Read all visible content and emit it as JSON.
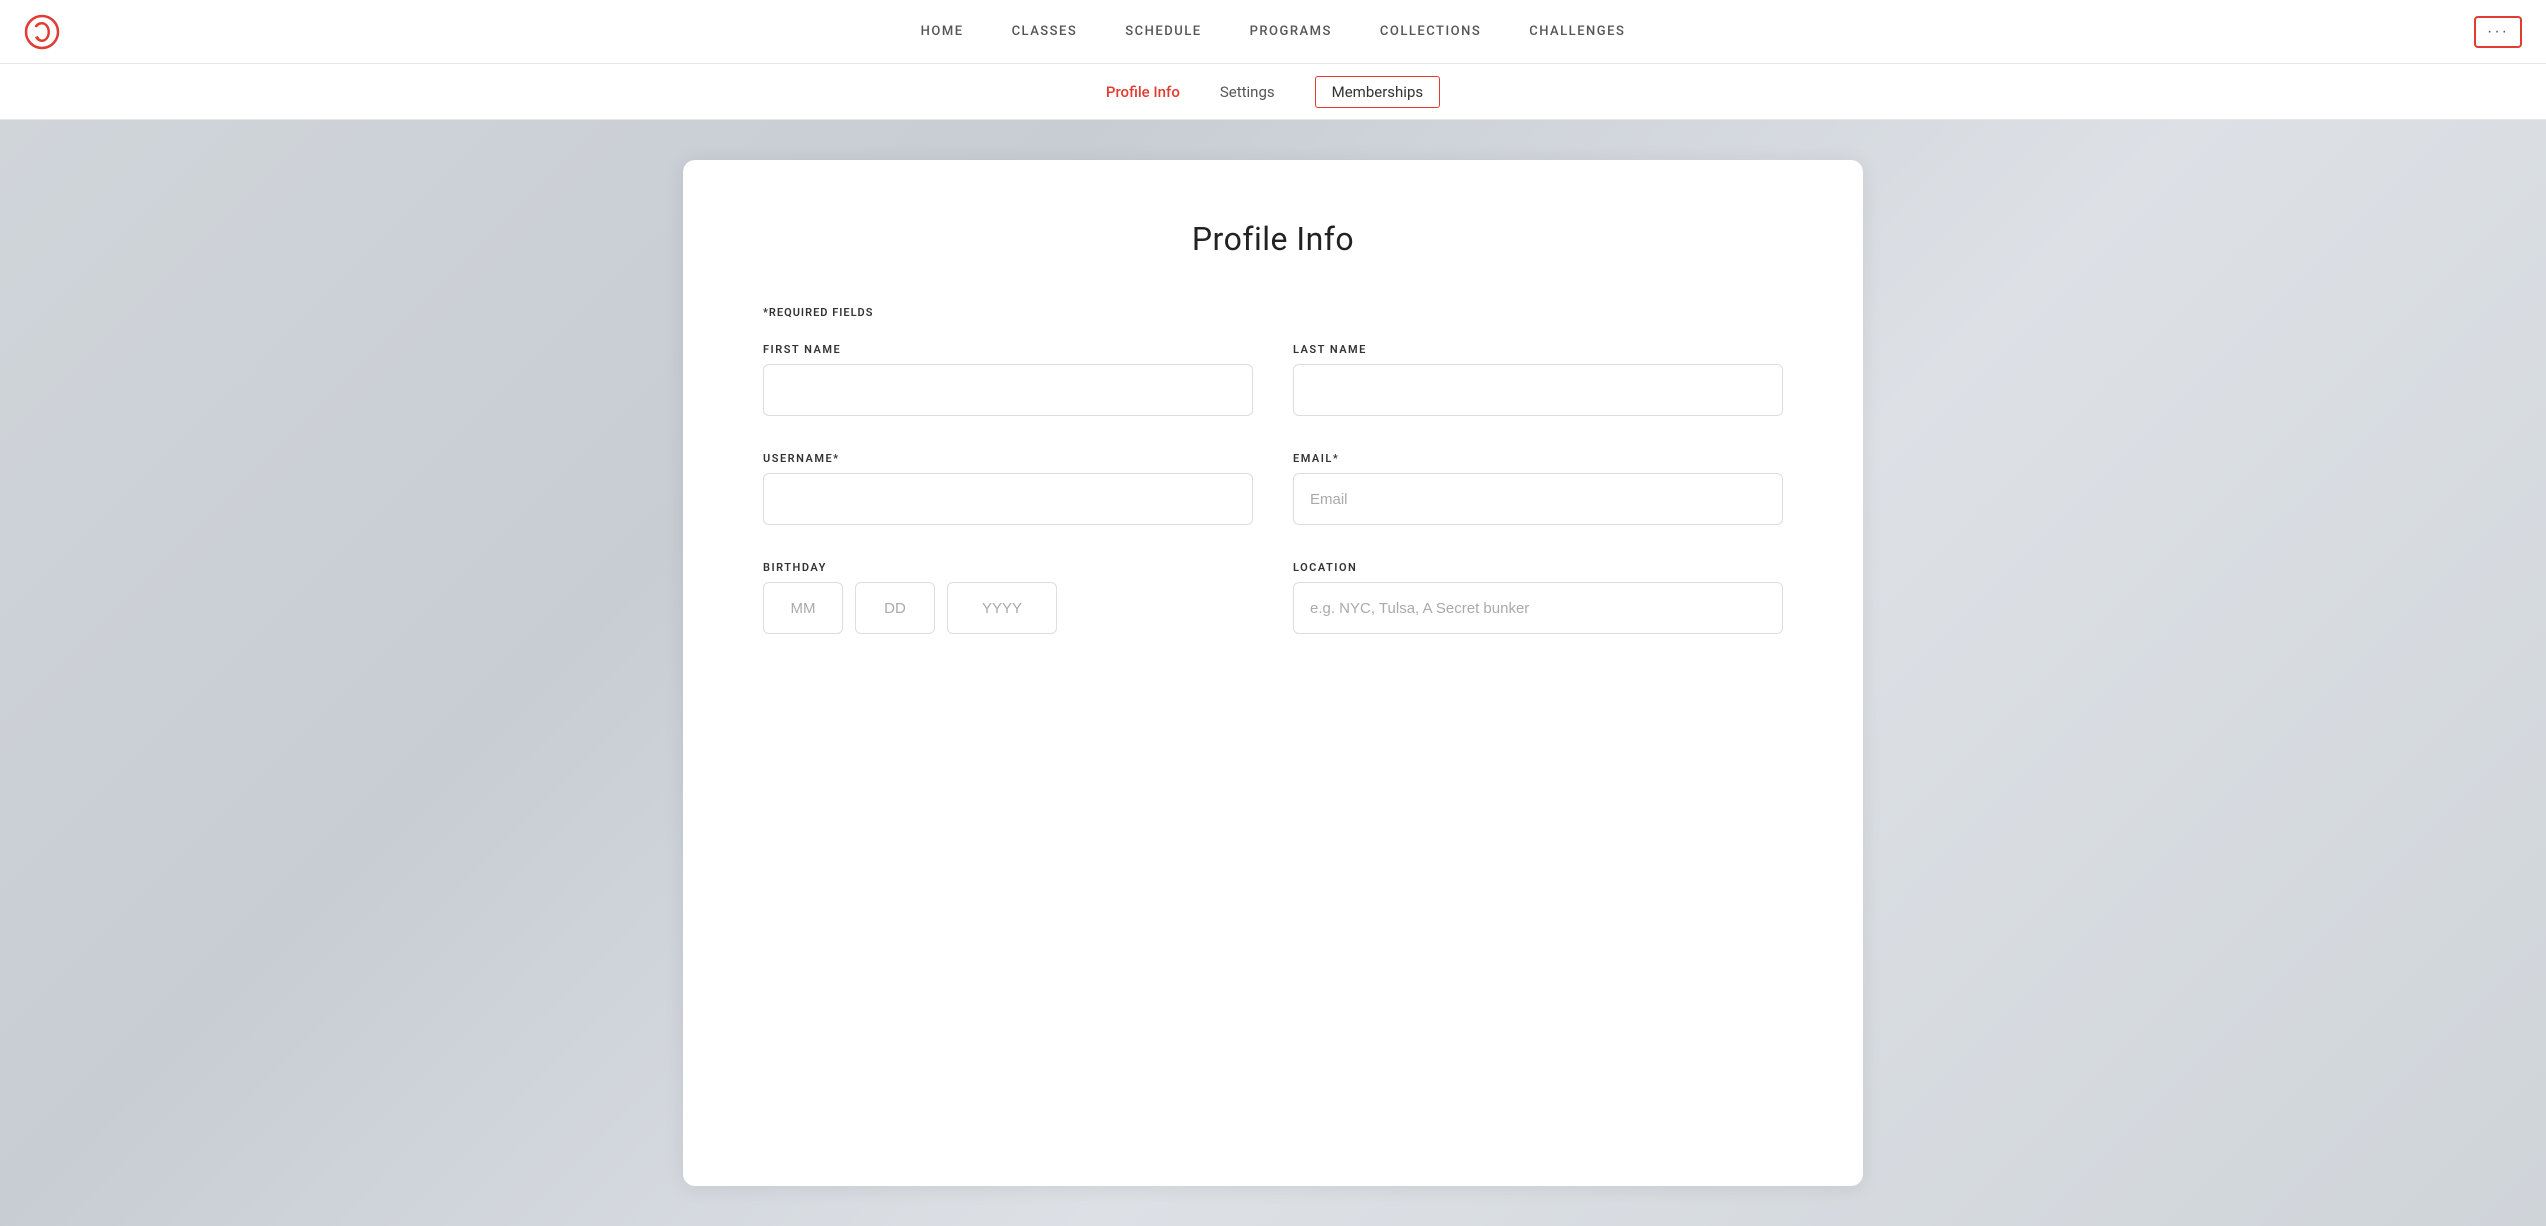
{
  "logo": {
    "alt": "Peloton Logo"
  },
  "nav": {
    "links": [
      {
        "label": "HOME",
        "id": "home"
      },
      {
        "label": "CLASSES",
        "id": "classes"
      },
      {
        "label": "SCHEDULE",
        "id": "schedule"
      },
      {
        "label": "PROGRAMS",
        "id": "programs"
      },
      {
        "label": "COLLECTIONS",
        "id": "collections"
      },
      {
        "label": "CHALLENGES",
        "id": "challenges"
      }
    ],
    "more_button_label": "···"
  },
  "sub_nav": {
    "tabs": [
      {
        "label": "Profile Info",
        "id": "profile-info",
        "active": true,
        "outlined": false
      },
      {
        "label": "Settings",
        "id": "settings",
        "active": false,
        "outlined": false
      },
      {
        "label": "Memberships",
        "id": "memberships",
        "active": false,
        "outlined": true
      }
    ]
  },
  "form": {
    "title": "Profile Info",
    "required_note": "*REQUIRED FIELDS",
    "fields": {
      "first_name_label": "FIRST NAME",
      "last_name_label": "LAST NAME",
      "username_label": "USERNAME*",
      "email_label": "EMAIL*",
      "email_placeholder": "Email",
      "birthday_label": "BIRTHDAY",
      "birthday_mm_placeholder": "MM",
      "birthday_dd_placeholder": "DD",
      "birthday_yyyy_placeholder": "YYYY",
      "location_label": "LOCATION",
      "location_placeholder": "e.g. NYC, Tulsa, A Secret bunker"
    }
  }
}
